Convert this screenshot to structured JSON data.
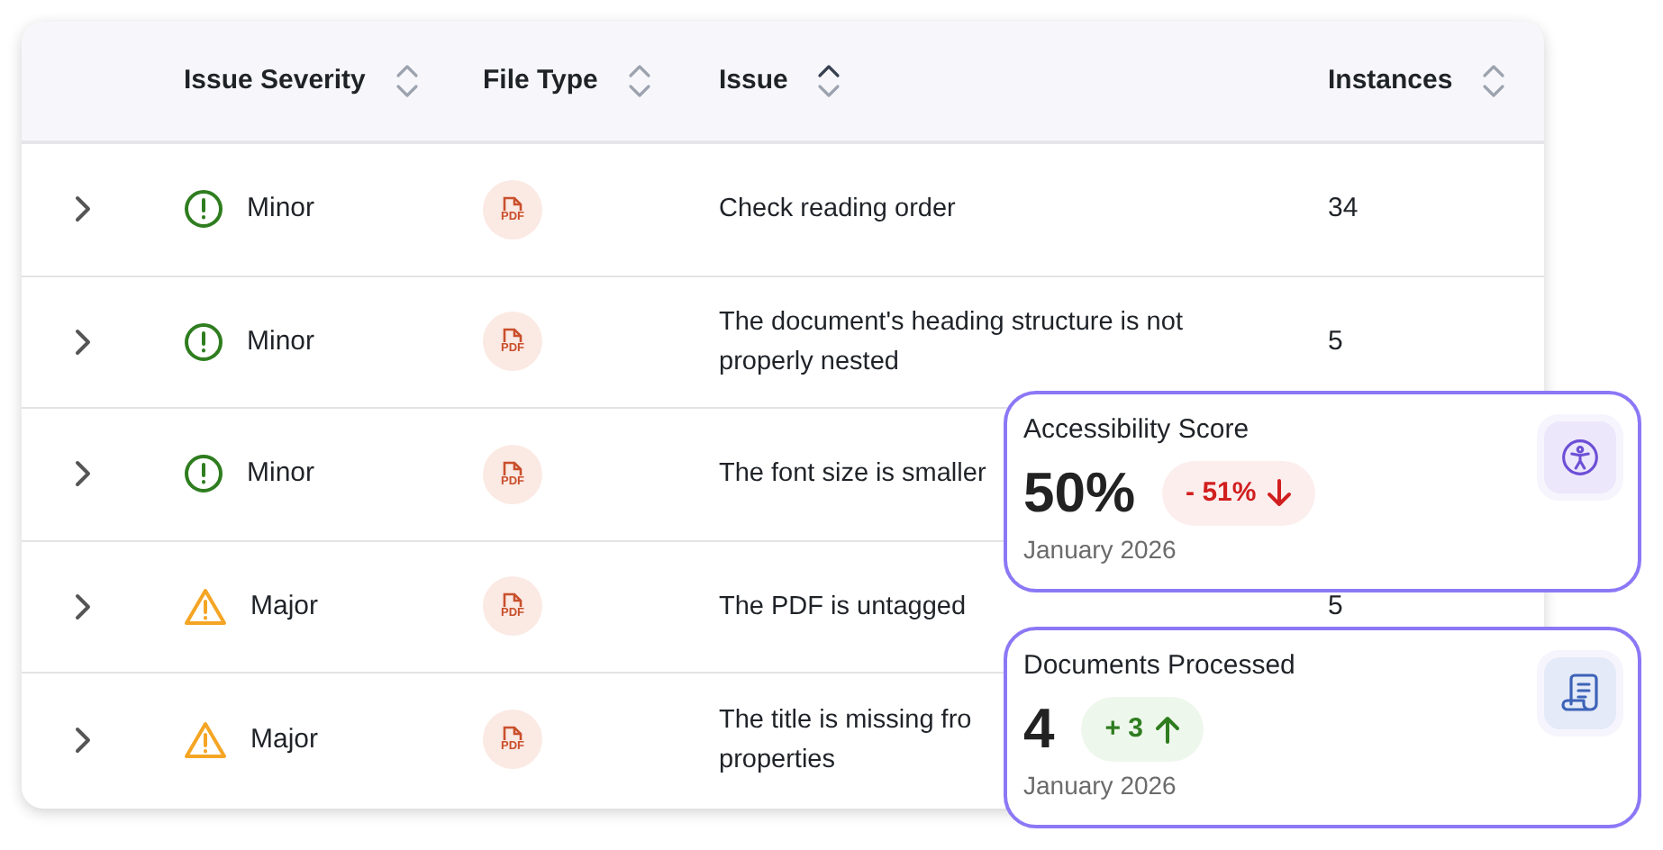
{
  "table": {
    "columns": [
      {
        "label": "Issue Severity",
        "sorted": false
      },
      {
        "label": "File Type",
        "sorted": false
      },
      {
        "label": "Issue",
        "sorted": true
      },
      {
        "label": "Instances",
        "sorted": false
      }
    ],
    "rows": [
      {
        "severity": {
          "kind": "minor",
          "label": "Minor"
        },
        "file_type": "PDF",
        "issue_lines": [
          "Check reading order"
        ],
        "instances": "34"
      },
      {
        "severity": {
          "kind": "minor",
          "label": "Minor"
        },
        "file_type": "PDF",
        "issue_lines": [
          "The document's heading structure is not",
          "properly nested"
        ],
        "instances": "5"
      },
      {
        "severity": {
          "kind": "minor",
          "label": "Minor"
        },
        "file_type": "PDF",
        "issue_lines": [
          "The font size is smaller"
        ]
      },
      {
        "severity": {
          "kind": "major",
          "label": "Major"
        },
        "file_type": "PDF",
        "issue_lines": [
          "The PDF is untagged"
        ],
        "instances": "5"
      },
      {
        "severity": {
          "kind": "major",
          "label": "Major"
        },
        "file_type": "PDF",
        "issue_lines": [
          "The title is missing fro",
          "properties"
        ]
      }
    ]
  },
  "cards": [
    {
      "kind": "accessibility",
      "title": "Accessibility Score",
      "value": "50%",
      "change": "- 51%",
      "increase": false,
      "period": "January 2026"
    },
    {
      "kind": "document",
      "title": "Documents Processed",
      "value": "4",
      "change": "+ 3",
      "increase": true,
      "period": "January 2026"
    }
  ]
}
